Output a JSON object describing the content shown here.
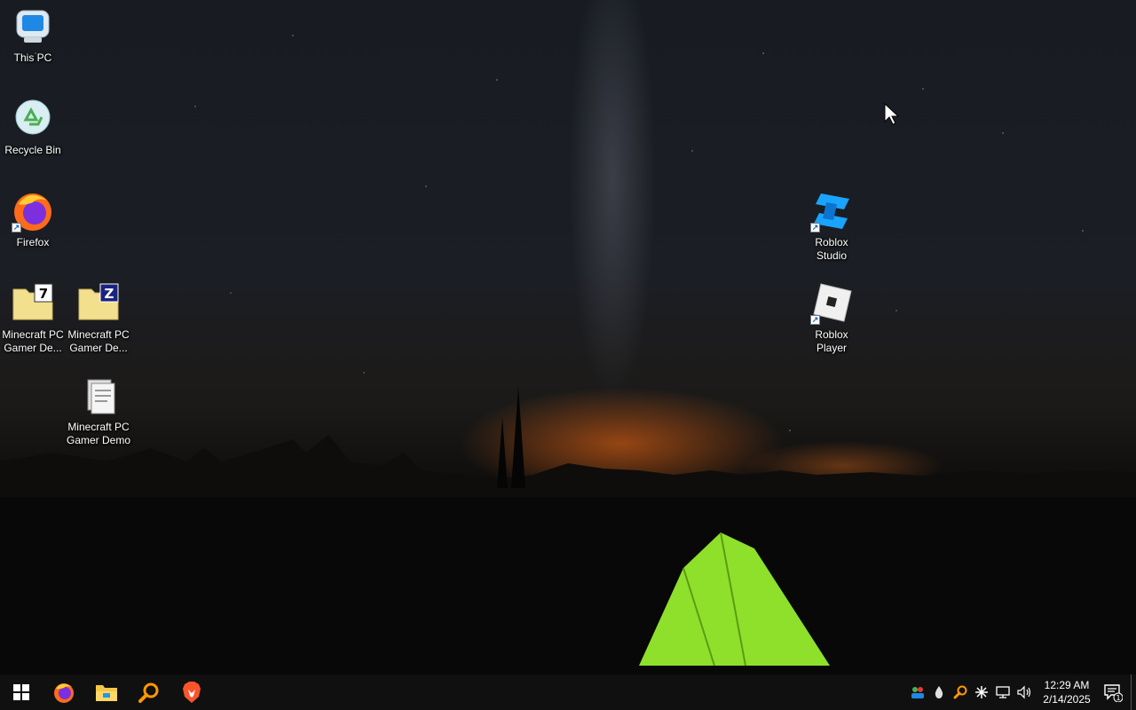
{
  "desktop": {
    "icons": [
      {
        "label": "This PC",
        "icon": "this-pc-icon"
      },
      {
        "label": "Recycle Bin",
        "icon": "recycle-bin-icon"
      },
      {
        "label": "Firefox",
        "icon": "firefox-icon"
      },
      {
        "label": "Minecraft PC Gamer De...",
        "icon": "7z-archive-icon"
      },
      {
        "label": "Minecraft PC Gamer De...",
        "icon": "zip-archive-icon"
      },
      {
        "label": "Minecraft PC Gamer Demo",
        "icon": "document-icon"
      },
      {
        "label": "Roblox Studio",
        "icon": "roblox-studio-icon"
      },
      {
        "label": "Roblox Player",
        "icon": "roblox-player-icon"
      }
    ]
  },
  "taskbar": {
    "pinned": [
      "windows-start-icon",
      "firefox-icon",
      "file-explorer-icon",
      "search-magnifier-icon",
      "brave-browser-icon"
    ],
    "tray_icons": [
      "people-icon",
      "water-drop-icon",
      "search-magnifier-icon",
      "snowflake-icon",
      "network-icon",
      "volume-icon"
    ],
    "clock": {
      "time": "12:29 AM",
      "date": "2/14/2025"
    },
    "notification_count": "1"
  },
  "colors": {
    "taskbar_bg": "#101010",
    "tent_green": "#8ee02a",
    "horizon_glow": "#ff6a14",
    "roblox_studio_blue": "#1aa3ff"
  }
}
